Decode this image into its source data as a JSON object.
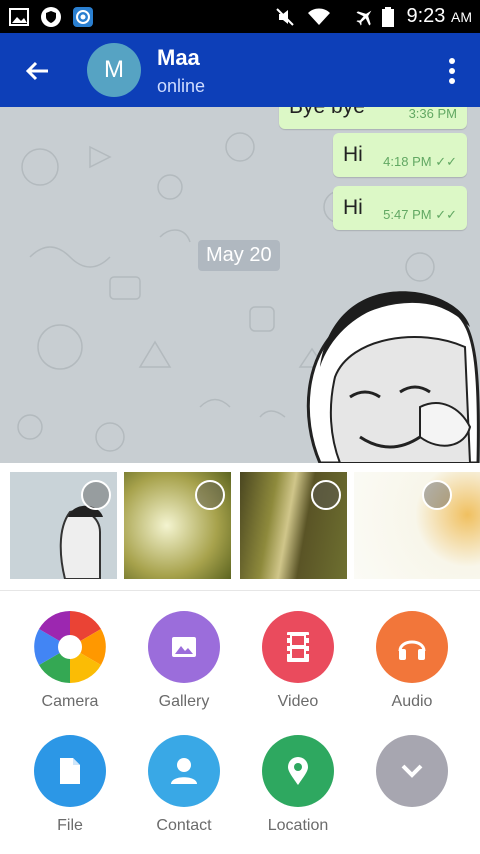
{
  "status": {
    "time": "9:23",
    "ampm": "AM"
  },
  "header": {
    "avatar_letter": "M",
    "name": "Maa",
    "status": "online"
  },
  "messages": [
    {
      "text": "Hi",
      "time": "4:18 PM",
      "ticks": "✓✓"
    },
    {
      "text": "Hi",
      "time": "5:47 PM",
      "ticks": "✓✓"
    }
  ],
  "partial_message": {
    "text": "Bye bye",
    "time": "3:36 PM"
  },
  "date_chip": "May 20",
  "actions": [
    {
      "label": "Camera",
      "color": "#ffffff"
    },
    {
      "label": "Gallery",
      "color": "#9b6ddb"
    },
    {
      "label": "Video",
      "color": "#ea4b5d"
    },
    {
      "label": "Audio",
      "color": "#f2763a"
    },
    {
      "label": "File",
      "color": "#2c97e6"
    },
    {
      "label": "Contact",
      "color": "#39a8e6"
    },
    {
      "label": "Location",
      "color": "#2ea860"
    },
    {
      "label": "",
      "color": "#a7a6b0"
    }
  ]
}
